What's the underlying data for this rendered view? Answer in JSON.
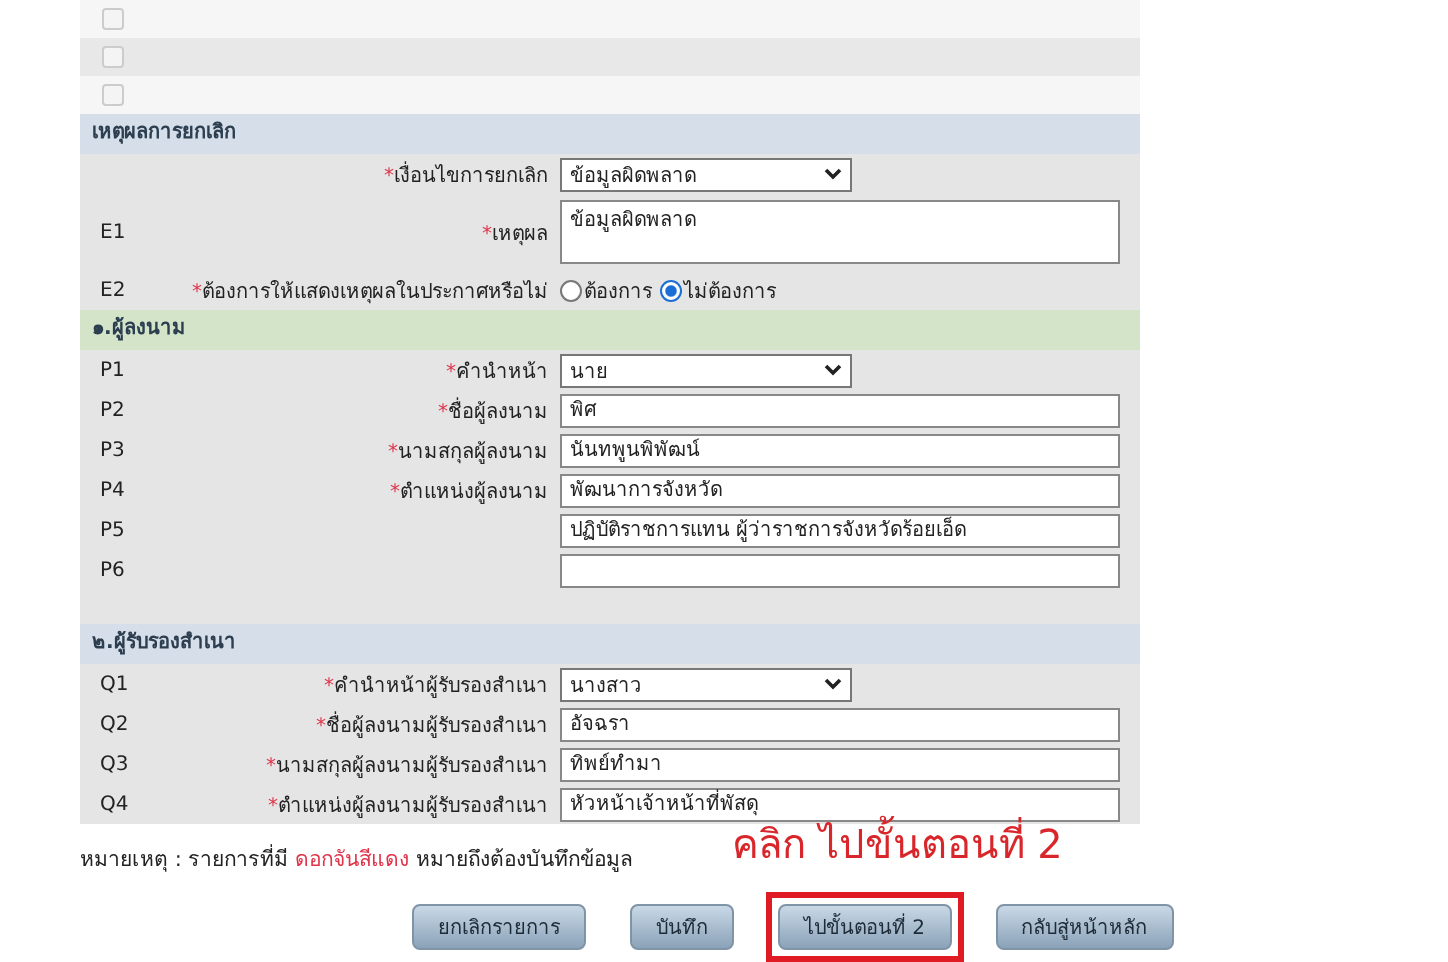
{
  "checkbox_rows": [
    {
      "checked": false
    },
    {
      "checked": false
    },
    {
      "checked": false
    }
  ],
  "sections": [
    {
      "title": "เหตุผลการยกเลิก",
      "color": "#d6dfe9",
      "rows": [
        {
          "code": "",
          "asterisk": "*",
          "label": "เงื่อนไขการยกเลิก",
          "kind": "select",
          "value": "ข้อมูลผิดพลาด"
        },
        {
          "code": "E1",
          "asterisk": "*",
          "label": "เหตุผล",
          "kind": "textarea",
          "value": "ข้อมูลผิดพลาด"
        },
        {
          "code": "E2",
          "asterisk": "*",
          "label": "ต้องการให้แสดงเหตุผลในประกาศหรือไม่",
          "kind": "radio",
          "options": [
            {
              "label": "ต้องการ",
              "selected": false
            },
            {
              "label": "ไม่ต้องการ",
              "selected": true
            }
          ]
        }
      ]
    },
    {
      "title": "๑.ผู้ลงนาม",
      "color": "#d3e4c9",
      "rows": [
        {
          "code": "P1",
          "asterisk": "*",
          "label": "คำนำหน้า",
          "kind": "select",
          "value": "นาย"
        },
        {
          "code": "P2",
          "asterisk": "*",
          "label": "ชื่อผู้ลงนาม",
          "kind": "text",
          "value": "พิศ"
        },
        {
          "code": "P3",
          "asterisk": "*",
          "label": "นามสกุลผู้ลงนาม",
          "kind": "text",
          "value": "นันทพูนพิพัฒน์"
        },
        {
          "code": "P4",
          "asterisk": "*",
          "label": "ตำแหน่งผู้ลงนาม",
          "kind": "text",
          "value": "พัฒนาการจังหวัด"
        },
        {
          "code": "P5",
          "asterisk": "",
          "label": "",
          "kind": "text",
          "value": "ปฏิบัติราชการแทน ผู้ว่าราชการจังหวัดร้อยเอ็ด"
        },
        {
          "code": "P6",
          "asterisk": "",
          "label": "",
          "kind": "text",
          "value": ""
        },
        {
          "code": "",
          "asterisk": "",
          "label": "",
          "kind": "blank"
        }
      ]
    },
    {
      "title": "๒.ผู้รับรองสำเนา",
      "color": "#d6dfe9",
      "rows": [
        {
          "code": "Q1",
          "asterisk": "*",
          "label": "คำนำหน้าผู้รับรองสำเนา",
          "kind": "select",
          "value": "นางสาว"
        },
        {
          "code": "Q2",
          "asterisk": "*",
          "label": "ชื่อผู้ลงนามผู้รับรองสำเนา",
          "kind": "text",
          "value": "อัจฉรา"
        },
        {
          "code": "Q3",
          "asterisk": "*",
          "label": "นามสกุลผู้ลงนามผู้รับรองสำเนา",
          "kind": "text",
          "value": "ทิพย์ทำมา"
        },
        {
          "code": "Q4",
          "asterisk": "*",
          "label": "ตำแหน่งผู้ลงนามผู้รับรองสำเนา",
          "kind": "text",
          "value": "หัวหน้าเจ้าหน้าที่พัสดุ"
        }
      ]
    }
  ],
  "note": {
    "lead": "หมายเหตุ : รายการที่มี",
    "red": "ดอกจันสีแดง",
    "tail": "หมายถึงต้องบันทึกข้อมูล"
  },
  "annotation": "คลิก ไปขั้นตอนที่ 2",
  "buttons": [
    {
      "label": "ยกเลิกรายการ",
      "highlighted": false
    },
    {
      "label": "บันทึก",
      "highlighted": false
    },
    {
      "label": "ไปขั้นตอนที่ 2",
      "highlighted": true
    },
    {
      "label": "กลับสู่หน้าหลัก",
      "highlighted": false
    }
  ]
}
